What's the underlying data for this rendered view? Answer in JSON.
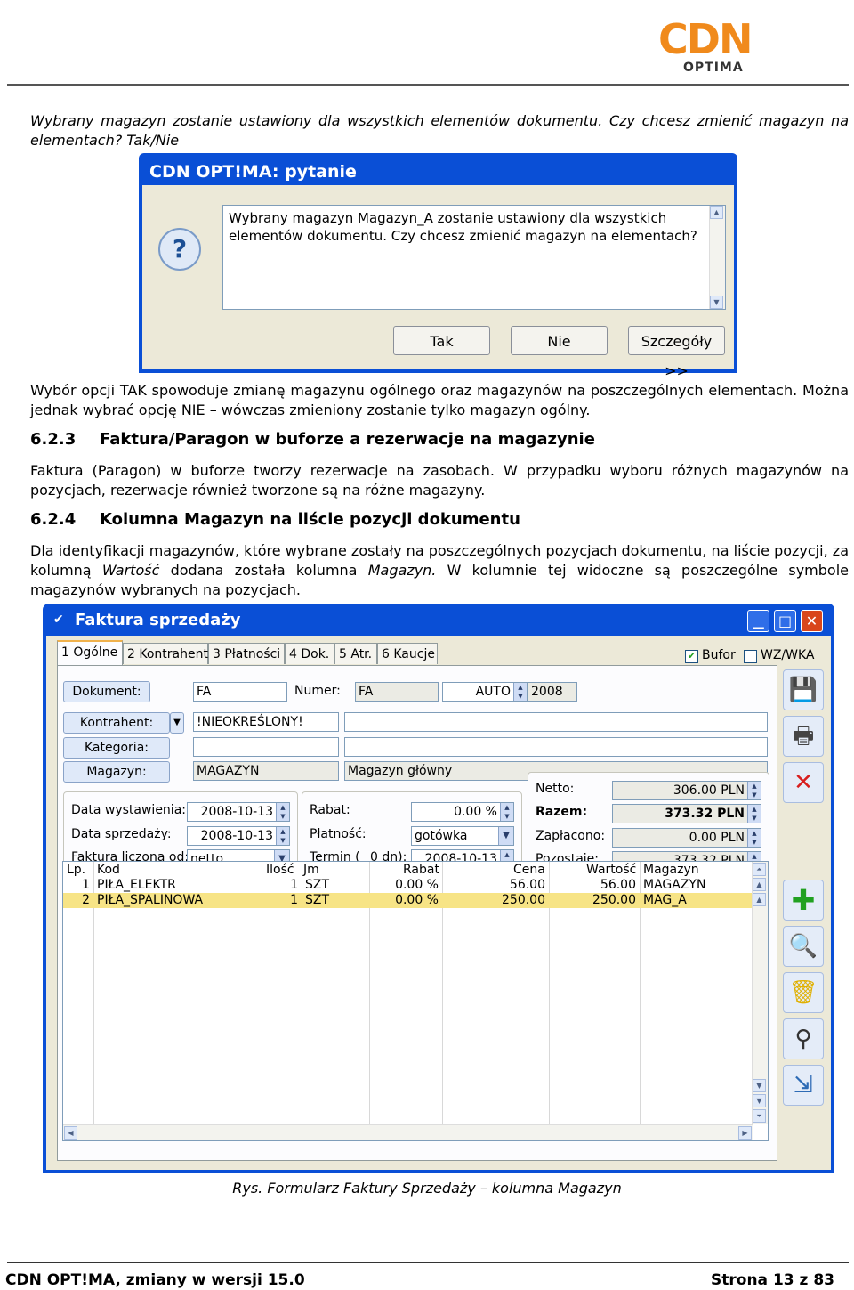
{
  "header": {
    "logo_text": "CDN",
    "logo_sub": "OPTIMA"
  },
  "intro": {
    "line": "Wybrany magazyn zostanie ustawiony dla wszystkich elementów dokumentu. Czy chcesz zmienić magazyn na elementach? Tak/Nie"
  },
  "dialog": {
    "title": "CDN OPT!MA: pytanie",
    "icon": "question-icon",
    "icon_glyph": "?",
    "message_line1": "Wybrany magazyn Magazyn_A zostanie ustawiony dla wszystkich",
    "message_line2": "elementów dokumentu. Czy chcesz zmienić magazyn na elementach?",
    "btn_yes": "Tak",
    "btn_no": "Nie",
    "btn_details": "Szczegóły >>"
  },
  "body": {
    "p1": "Wybór opcji TAK spowoduje zmianę magazynu ogólnego oraz magazynów na poszczególnych elementach. Można jednak wybrać opcję NIE – wówczas zmieniony zostanie tylko magazyn ogólny.",
    "s1_num": "6.2.3",
    "s1_title": "Faktura/Paragon w buforze a rezerwacje na magazynie",
    "p2": "Faktura (Paragon) w buforze tworzy rezerwacje na zasobach. W przypadku wyboru różnych magazynów na pozycjach, rezerwacje również tworzone są na różne magazyny.",
    "s2_num": "6.2.4",
    "s2_title": "Kolumna Magazyn na liście pozycji dokumentu",
    "p3_a": "Dla identyfikacji magazynów, które wybrane zostały na poszczególnych pozycjach dokumentu, na liście pozycji, za kolumną ",
    "p3_i1": "Wartość",
    "p3_b": " dodana została kolumna ",
    "p3_i2": "Magazyn.",
    "p3_c": " W kolumnie tej widoczne są poszczególne symbole magazynów wybranych na pozycjach."
  },
  "form": {
    "title": "Faktura sprzedaży",
    "tabs": [
      "1 Ogólne",
      "2 Kontrahent",
      "3 Płatności",
      "4 Dok.",
      "5 Atr.",
      "6 Kaucje"
    ],
    "bufor_label": "Bufor",
    "wzwka_label": "WZ/WKA",
    "dokument_btn": "Dokument:",
    "dokument_val": "FA",
    "numer_label": "Numer:",
    "numer_val": "FA",
    "auto_val": "AUTO",
    "year_val": "2008",
    "kontrahent_btn": "Kontrahent:",
    "kontrahent_val": "!NIEOKREŚLONY!",
    "kategoria_btn": "Kategoria:",
    "magazyn_btn": "Magazyn:",
    "magazyn_val": "MAGAZYN",
    "magazyn_name": "Magazyn główny",
    "data_wyst_label": "Data wystawienia:",
    "data_wyst_val": "2008-10-13",
    "data_sprz_label": "Data sprzedaży:",
    "data_sprz_val": "2008-10-13",
    "liczona_label": "Faktura liczona od:",
    "liczona_val": "netto",
    "rabat_label": "Rabat:",
    "rabat_val": "0.00 %",
    "platnosc_label": "Płatność:",
    "platnosc_val": "gotówka",
    "termin_label": "Termin (",
    "termin_days": "0 dn):",
    "termin_val": "2008-10-13",
    "netto_label": "Netto:",
    "netto_val": "306.00 PLN",
    "razem_label": "Razem:",
    "razem_val": "373.32 PLN",
    "zaplacono_label": "Zapłacono:",
    "zaplacono_val": "0.00 PLN",
    "pozostaje_label": "Pozostaje:",
    "pozostaje_val": "373.32 PLN",
    "columns": [
      "Lp.",
      "Kod",
      "Ilość",
      "Jm",
      "Rabat",
      "Cena",
      "Wartość",
      "Magazyn"
    ],
    "rows": [
      {
        "lp": "1",
        "kod": "PIŁA_ELEKTR",
        "ilosc": "1",
        "jm": "SZT",
        "rabat": "0.00 %",
        "cena": "56.00",
        "wartosc": "56.00",
        "magazyn": "MAGAZYN"
      },
      {
        "lp": "2",
        "kod": "PIŁA_SPALINOWA",
        "ilosc": "1",
        "jm": "SZT",
        "rabat": "0.00 %",
        "cena": "250.00",
        "wartosc": "250.00",
        "magazyn": "MAG_A"
      }
    ],
    "toolbar": [
      "save-icon",
      "print-icon",
      "cancel-icon",
      "add-icon",
      "edit-icon",
      "delete-icon",
      "search-icon",
      "export-icon"
    ],
    "colors": {
      "title_bar": "#0a4fd6",
      "selected_row": "#f7e486",
      "ok_green": "#21a121",
      "cancel_red": "#d81e1e"
    }
  },
  "caption": "Rys. Formularz Faktury Sprzedaży – kolumna Magazyn",
  "footer": {
    "left": "CDN OPT!MA, zmiany w wersji 15.0",
    "right": "Strona 13 z 83"
  }
}
